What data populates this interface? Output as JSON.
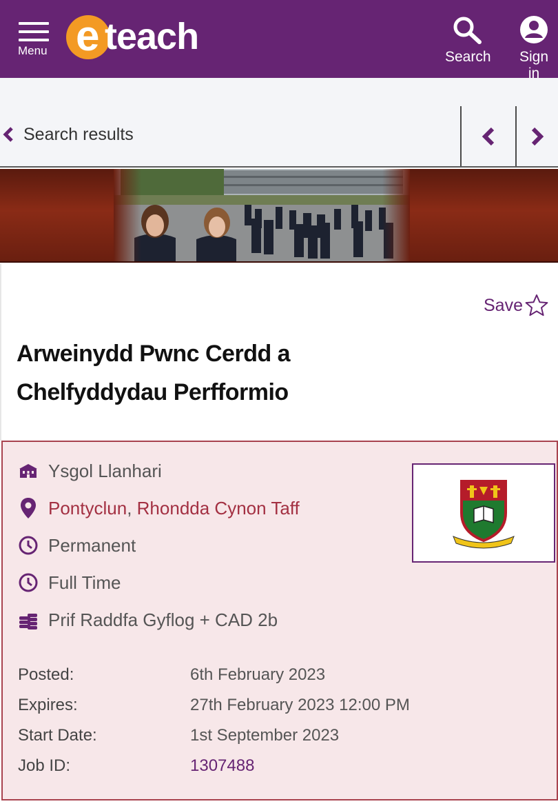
{
  "header": {
    "menu_label": "Menu",
    "logo_e": "e",
    "logo_rest": "teach",
    "search_label": "Search",
    "signin_label": "Sign in",
    "bg_color": "#662473"
  },
  "results_bar": {
    "back_label": "Search results"
  },
  "job": {
    "save_label": "Save",
    "title_line1": "Arweinydd Pwnc Cerdd a",
    "title_line2": "Chelfyddydau Perfformio"
  },
  "details": {
    "school": "Ysgol Llanhari",
    "town": "Pontyclun",
    "separator": ",",
    "county": "Rhondda Cynon Taff",
    "contract": "Permanent",
    "hours": "Full Time",
    "salary": "Prif Raddfa Gyflog + CAD 2b",
    "meta": [
      {
        "label": "Posted:",
        "value": "6th February 2023"
      },
      {
        "label": "Expires:",
        "value": "27th February 2023 12:00 PM"
      },
      {
        "label": "Start Date:",
        "value": "1st September 2023"
      },
      {
        "label": "Job ID:",
        "value": "1307488"
      }
    ]
  },
  "icons": {
    "menu": "hamburger-icon",
    "search": "search-icon",
    "user": "user-icon",
    "back": "chevron-left-icon",
    "prev": "chevron-left-icon",
    "next": "chevron-right-icon",
    "save": "star-outline-icon",
    "school": "school-building-icon",
    "location": "map-pin-icon",
    "clock": "clock-icon",
    "salary": "coins-icon"
  },
  "colors": {
    "brand_purple": "#662473",
    "brand_orange": "#f39a24",
    "link_red": "#a33042",
    "details_bg": "#f7e7e9"
  }
}
